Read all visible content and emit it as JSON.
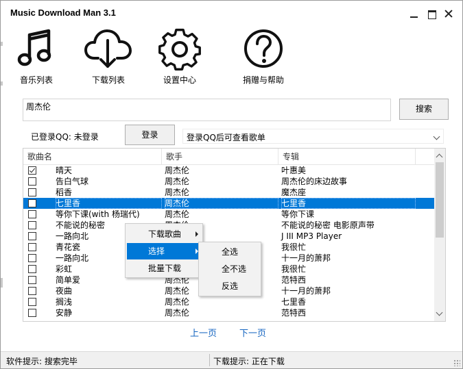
{
  "window": {
    "title": "Music Download Man 3.1"
  },
  "toolbar": {
    "music_list": "音乐列表",
    "download_list": "下载列表",
    "settings": "设置中心",
    "donate_help": "捐赠与帮助"
  },
  "search": {
    "value": "周杰伦",
    "button": "搜索"
  },
  "login": {
    "status": "已登录QQ: 未登录",
    "button": "登录",
    "playlist_select": "登录QQ后可查看歌单"
  },
  "table": {
    "headers": {
      "name": "歌曲名",
      "artist": "歌手",
      "album": "专辑"
    },
    "rows": [
      {
        "checked": true,
        "name": "晴天",
        "artist": "周杰伦",
        "album": "叶惠美"
      },
      {
        "checked": false,
        "name": "告白气球",
        "artist": "周杰伦",
        "album": "周杰伦的床边故事"
      },
      {
        "checked": false,
        "name": "稻香",
        "artist": "周杰伦",
        "album": "魔杰座"
      },
      {
        "checked": false,
        "name": "七里香",
        "artist": "周杰伦",
        "album": "七里香",
        "selected": true
      },
      {
        "checked": false,
        "name": "等你下课(with 杨瑞代)",
        "artist": "周杰伦",
        "album": "等你下课"
      },
      {
        "checked": false,
        "name": "不能说的秘密",
        "artist": "周杰伦",
        "album": "不能说的秘密 电影原声带"
      },
      {
        "checked": false,
        "name": "一路向北",
        "artist": "周杰伦",
        "album": "J III MP3 Player"
      },
      {
        "checked": false,
        "name": "青花瓷",
        "artist": "周杰伦",
        "album": "我很忙"
      },
      {
        "checked": false,
        "name": "一路向北",
        "artist": "周杰伦",
        "album": "十一月的萧邦"
      },
      {
        "checked": false,
        "name": "彩虹",
        "artist": "周杰伦",
        "album": "我很忙"
      },
      {
        "checked": false,
        "name": "简单爱",
        "artist": "周杰伦",
        "album": "范特西"
      },
      {
        "checked": false,
        "name": "夜曲",
        "artist": "周杰伦",
        "album": "十一月的萧邦"
      },
      {
        "checked": false,
        "name": "搁浅",
        "artist": "周杰伦",
        "album": "七里香"
      },
      {
        "checked": false,
        "name": "安静",
        "artist": "周杰伦",
        "album": "范特西"
      }
    ]
  },
  "pagination": {
    "prev": "上一页",
    "next": "下一页"
  },
  "context_menu": {
    "download_song": "下载歌曲",
    "select": "选择",
    "batch_download": "批量下载",
    "submenu": {
      "select_all": "全选",
      "select_none": "全不选",
      "invert": "反选"
    }
  },
  "statusbar": {
    "software_status": "软件提示: 搜索完毕",
    "download_status": "下载提示: 正在下载"
  },
  "icons": {
    "music_list": "music-note-icon",
    "download_list": "cloud-download-icon",
    "settings": "gear-icon",
    "help": "question-circle-icon"
  },
  "colors": {
    "selection": "#0078d7",
    "link": "#1565c0"
  }
}
